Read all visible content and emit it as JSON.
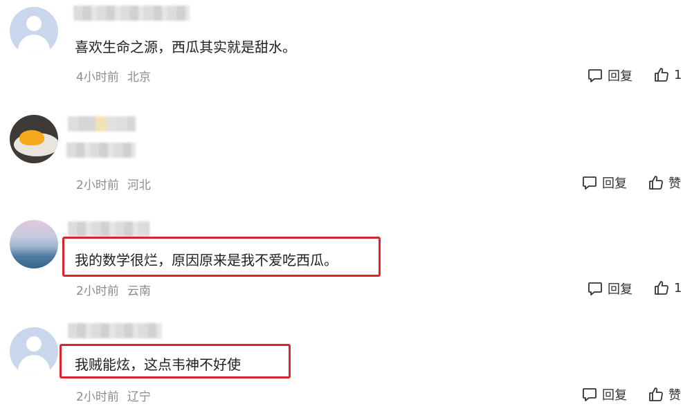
{
  "comments": [
    {
      "text": "喜欢生命之源，西瓜其实就是甜水。",
      "time": "4小时前",
      "location": "北京",
      "reply_label": "回复",
      "like_label": "1",
      "avatar": "default-avatar",
      "highlighted": false
    },
    {
      "text": "",
      "time": "2小时前",
      "location": "河北",
      "reply_label": "回复",
      "like_label": "赞",
      "avatar": "food-photo-avatar",
      "highlighted": false
    },
    {
      "text": "我的数学很烂，原因原来是我不爱吃西瓜。",
      "time": "2小时前",
      "location": "云南",
      "reply_label": "回复",
      "like_label": "1",
      "avatar": "sky-photo-avatar",
      "highlighted": true
    },
    {
      "text": "我贼能炫，这点韦神不好使",
      "time": "2小时前",
      "location": "辽宁",
      "reply_label": "回复",
      "like_label": "赞",
      "avatar": "default-avatar",
      "highlighted": true
    }
  ],
  "colors": {
    "highlight_border": "#d9252a",
    "meta_text": "#8c8c8c",
    "default_avatar_bg": "#c9d6ec"
  },
  "icons": {
    "reply": "comment-bubble-icon",
    "like": "thumbs-up-icon"
  }
}
